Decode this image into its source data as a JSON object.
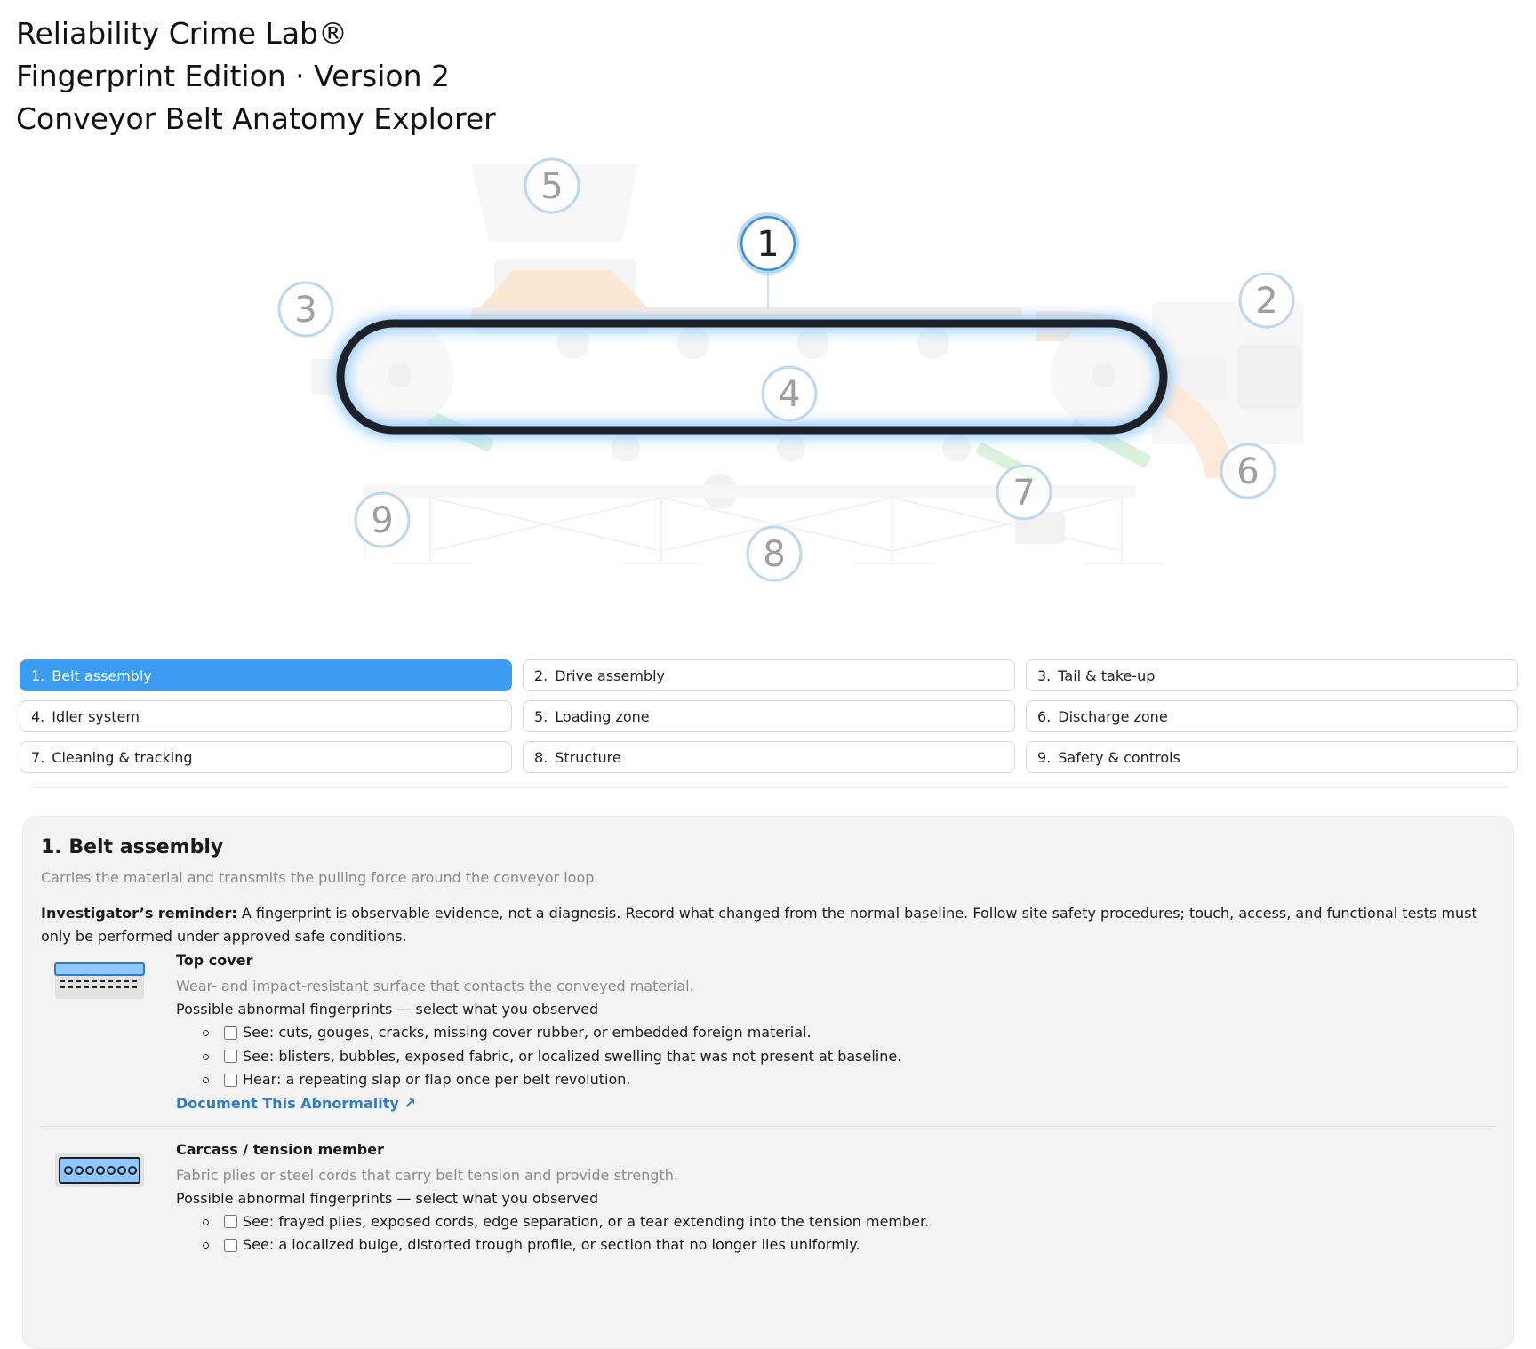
{
  "header": {
    "line1": "Reliability Crime Lab®",
    "line2": "Fingerprint Edition · Version 2",
    "line3": "Conveyor Belt Anatomy Explorer"
  },
  "diagram": {
    "hotspots": [
      "1",
      "2",
      "3",
      "4",
      "5",
      "6",
      "7",
      "8",
      "9"
    ],
    "active": "1",
    "colors": {
      "belt": "#1d2126",
      "glow": "#8fc7ff",
      "hotspot": "#bcd7ee",
      "active_hotspot": "#3b8fd6",
      "material": "#f9c9a0",
      "scraper": "#a8dcb0"
    }
  },
  "parts": [
    {
      "num": "1.",
      "label": "Belt assembly",
      "active": true
    },
    {
      "num": "2.",
      "label": "Drive assembly"
    },
    {
      "num": "3.",
      "label": "Tail & take-up"
    },
    {
      "num": "4.",
      "label": "Idler system"
    },
    {
      "num": "5.",
      "label": "Loading zone"
    },
    {
      "num": "6.",
      "label": "Discharge zone"
    },
    {
      "num": "7.",
      "label": "Cleaning & tracking"
    },
    {
      "num": "8.",
      "label": "Structure"
    },
    {
      "num": "9.",
      "label": "Safety & controls"
    }
  ],
  "detail": {
    "title": "1. Belt assembly",
    "subtitle": "Carries the material and transmits the pulling force around the conveyor loop.",
    "reminder_label": "Investigator’s reminder:",
    "reminder_text": " A fingerprint is observable evidence, not a diagnosis. Record what changed from the normal baseline. Follow site safety procedures; touch, access, and functional tests must only be performed under approved safe conditions.",
    "components": [
      {
        "name": "Top cover",
        "icon": "top-cover-icon",
        "desc": "Wear- and impact-resistant surface that contacts the conveyed material.",
        "prompt": "Possible abnormal fingerprints — select what you observed",
        "items": [
          "See: cuts, gouges, cracks, missing cover rubber, or embedded foreign material.",
          "See: blisters, bubbles, exposed fabric, or localized swelling that was not present at baseline.",
          "Hear: a repeating slap or flap once per belt revolution."
        ],
        "link": "Document This Abnormality ↗"
      },
      {
        "name": "Carcass / tension member",
        "icon": "carcass-icon",
        "desc": "Fabric plies or steel cords that carry belt tension and provide strength.",
        "prompt": "Possible abnormal fingerprints — select what you observed",
        "items": [
          "See: frayed plies, exposed cords, edge separation, or a tear extending into the tension member.",
          "See: a localized bulge, distorted trough profile, or section that no longer lies uniformly."
        ]
      }
    ]
  }
}
